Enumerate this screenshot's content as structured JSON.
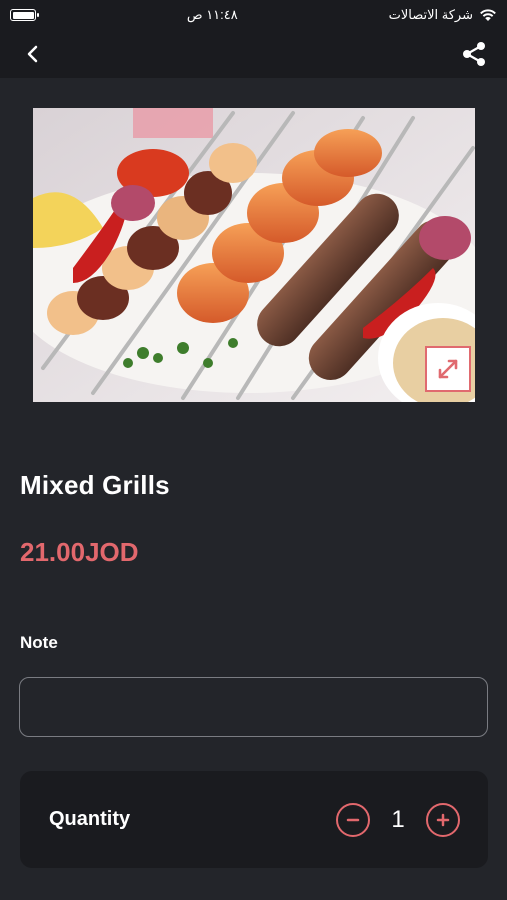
{
  "status_bar": {
    "carrier": "شركة الاتصالات",
    "time": "١١:٤٨ ص"
  },
  "nav": {
    "back_icon": "chevron-left-icon",
    "share_icon": "share-icon"
  },
  "item": {
    "image_alt": "Mixed grills skewers",
    "title": "Mixed Grills",
    "price": "21.00JOD"
  },
  "note": {
    "label": "Note",
    "value": "",
    "placeholder": ""
  },
  "quantity": {
    "label": "Quantity",
    "value": "1"
  },
  "colors": {
    "accent": "#e2686d",
    "background": "#23252a",
    "bar": "#1a1b1f"
  }
}
